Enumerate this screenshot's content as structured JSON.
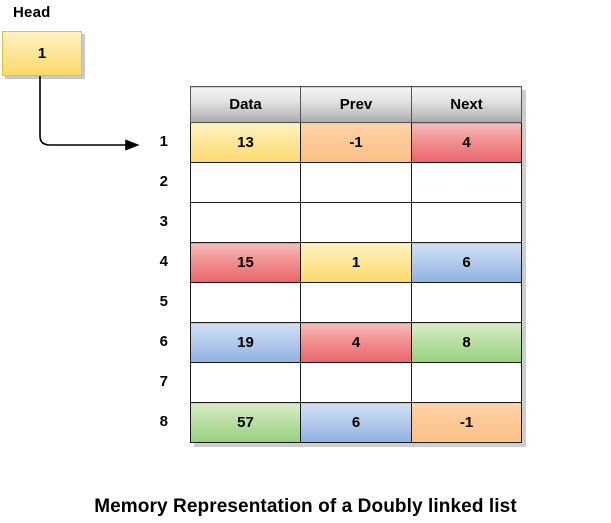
{
  "head": {
    "label": "Head",
    "node_value": "1",
    "box_color": "#fbd96a",
    "arrow_target_row": "1"
  },
  "table": {
    "columns": [
      "Data",
      "Prev",
      "Next"
    ],
    "row_indices": [
      "1",
      "2",
      "3",
      "4",
      "5",
      "6",
      "7",
      "8"
    ],
    "rows": [
      {
        "index": "1",
        "data": "13",
        "prev": "-1",
        "next": "4",
        "data_fill": "yellow",
        "prev_fill": "orange",
        "next_fill": "red"
      },
      {
        "index": "2",
        "data": "",
        "prev": "",
        "next": "",
        "data_fill": "none",
        "prev_fill": "none",
        "next_fill": "none"
      },
      {
        "index": "3",
        "data": "",
        "prev": "",
        "next": "",
        "data_fill": "none",
        "prev_fill": "none",
        "next_fill": "none"
      },
      {
        "index": "4",
        "data": "15",
        "prev": "1",
        "next": "6",
        "data_fill": "red",
        "prev_fill": "yellow",
        "next_fill": "blue"
      },
      {
        "index": "5",
        "data": "",
        "prev": "",
        "next": "",
        "data_fill": "none",
        "prev_fill": "none",
        "next_fill": "none"
      },
      {
        "index": "6",
        "data": "19",
        "prev": "4",
        "next": "8",
        "data_fill": "blue",
        "prev_fill": "red",
        "next_fill": "green"
      },
      {
        "index": "7",
        "data": "",
        "prev": "",
        "next": "",
        "data_fill": "none",
        "prev_fill": "none",
        "next_fill": "none"
      },
      {
        "index": "8",
        "data": "57",
        "prev": "6",
        "next": "-1",
        "data_fill": "green",
        "prev_fill": "blue",
        "next_fill": "orange"
      }
    ]
  },
  "caption": "Memory Representation of a Doubly linked list",
  "colors": {
    "yellow": "#fbd96a",
    "orange": "#fcc793",
    "red": "#e8646c",
    "blue": "#90b0e0",
    "green": "#97d07f",
    "header_gray": "#c4c4c4",
    "shadow": "#cdcdcd"
  }
}
